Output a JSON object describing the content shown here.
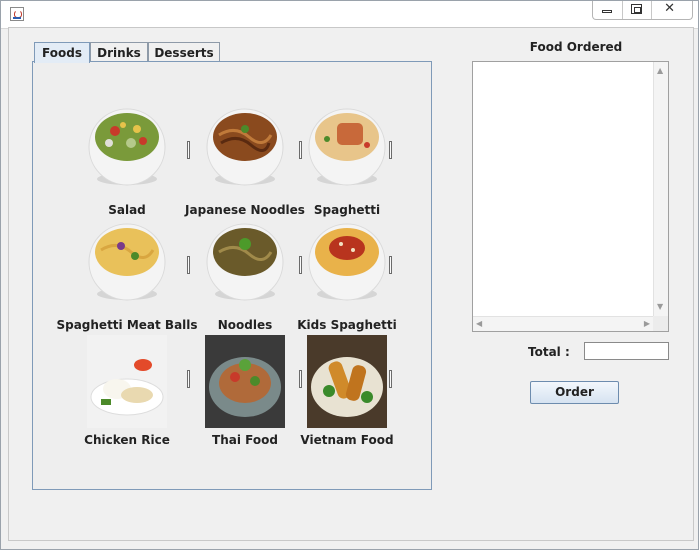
{
  "window": {
    "title": ""
  },
  "tabs": [
    {
      "label": "Foods",
      "active": true
    },
    {
      "label": "Drinks",
      "active": false
    },
    {
      "label": "Desserts",
      "active": false
    }
  ],
  "foods": [
    {
      "name": "Salad",
      "icon": "salad-bowl-image"
    },
    {
      "name": "Japanese Noodles",
      "icon": "noodle-bowl-image"
    },
    {
      "name": "Spaghetti",
      "icon": "spaghetti-bowl-image"
    },
    {
      "name": "Spaghetti Meat Balls",
      "icon": "spaghetti-bowl-image"
    },
    {
      "name": "Noodles",
      "icon": "noodle-bowl-image"
    },
    {
      "name": "Kids Spaghetti",
      "icon": "spaghetti-bowl-image"
    },
    {
      "name": "Chicken Rice",
      "icon": "chicken-rice-plate-image"
    },
    {
      "name": "Thai Food",
      "icon": "thai-salad-plate-image"
    },
    {
      "name": "Vietnam Food",
      "icon": "vietnam-food-plate-image"
    }
  ],
  "order_panel": {
    "title": "Food Ordered",
    "content": "",
    "total_label": "Total :",
    "total_value": "",
    "order_button": "Order"
  },
  "colors": {
    "tab_active": "#e3ecf6",
    "button_gradient_top": "#f3f7fc",
    "button_gradient_bottom": "#d6e3f1",
    "panel_background": "#f0f0f0"
  }
}
